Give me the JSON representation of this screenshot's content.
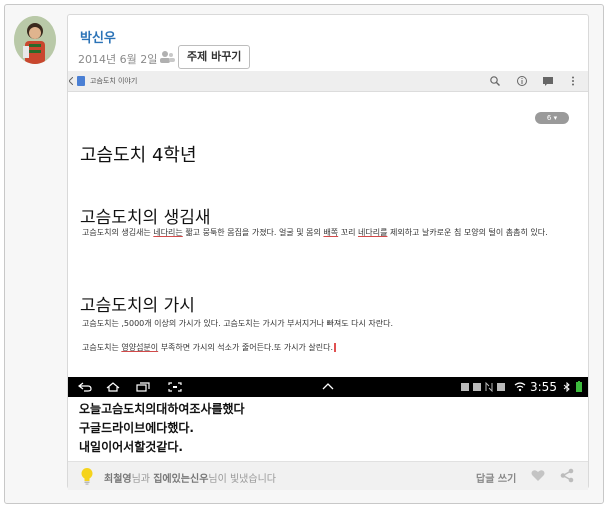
{
  "post": {
    "author": "박신우",
    "date": "2014년 6월 2일",
    "topic_button": "주제 바꾸기",
    "caption_lines": [
      "오늘고슴도치의대하여조사를했다",
      "구글드라이브에다했다.",
      "내일이어서할것같다."
    ]
  },
  "doc": {
    "toolbar_title": "고슴도치 이야기",
    "chip": "6 ▾",
    "heading1": "고슴도치   4학년",
    "section1_title": "고슴도치의 생김새",
    "section1_text_a": "고슴도치의 생김새는 ",
    "section1_u1": "네다리는",
    "section1_text_b": " 짧고  뭉툭한 몸집을 가졌다. 얼굴 및 몸의 ",
    "section1_u2": "배쪽",
    "section1_text_c": " 꼬리 ",
    "section1_u3": "네다리를",
    "section1_text_d": " 제외하고 날카로운 침 모양의 털이 촘촘히 있다.",
    "section2_title": "고슴도치의 가시",
    "section2_text1": "고슴도치는 ,5000개 이상의 가시가 있다. 고슴도치는 가시가 부서지거나 빠져도 다시 자란다.",
    "section2_text2_a": "고슴도치는 ",
    "section2_u1": "영양섭분이",
    "section2_text2_b": " 부족하면 가시의 석소가 줄어든다.또 가시가  살린다."
  },
  "status": {
    "time": "3:55"
  },
  "footer": {
    "liker1": "최철영",
    "liker_mid": "님과 ",
    "liker2": "집에있는신우",
    "liker_end": "님이 빛냈습니다",
    "reply_label": "답글 쓰기"
  }
}
